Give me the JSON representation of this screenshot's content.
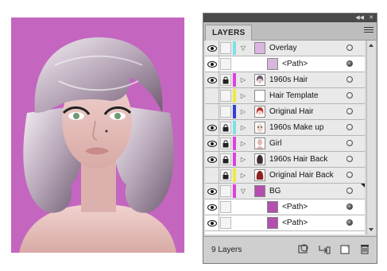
{
  "artwork": {
    "description_label": ""
  },
  "panel": {
    "tab_label": "LAYERS",
    "layer_count_label": "9 Layers",
    "footer_buttons": [
      "make-clip-mask",
      "create-sublayer",
      "create-layer",
      "delete-layer"
    ]
  },
  "layers": [
    {
      "name": "Overlay",
      "expander": "▽",
      "color": "#7ee0e8",
      "visible": true,
      "locked": false,
      "thumb": "lilac",
      "level": 0,
      "selected_corner": false
    },
    {
      "name": "<Path>",
      "expander": "",
      "color": "",
      "visible": true,
      "locked": false,
      "thumb": "lilac",
      "level": 1,
      "selected_corner": false
    },
    {
      "name": "1960s Hair",
      "expander": "▷",
      "color": "#e040e0",
      "visible": true,
      "locked": true,
      "thumb": "hair",
      "level": 0,
      "selected_corner": false
    },
    {
      "name": "Hair Template",
      "expander": "▷",
      "color": "#f0e840",
      "visible": false,
      "locked": false,
      "thumb": "blank",
      "level": 0,
      "selected_corner": false
    },
    {
      "name": "Original Hair",
      "expander": "▷",
      "color": "#3040d8",
      "visible": false,
      "locked": false,
      "thumb": "redhair",
      "level": 0,
      "selected_corner": false
    },
    {
      "name": "1960s Make up",
      "expander": "▷",
      "color": "#7ee0e8",
      "visible": true,
      "locked": true,
      "thumb": "face",
      "level": 0,
      "selected_corner": false
    },
    {
      "name": "Girl",
      "expander": "▷",
      "color": "#e040e0",
      "visible": true,
      "locked": true,
      "thumb": "girl",
      "level": 0,
      "selected_corner": false
    },
    {
      "name": "1960s Hair Back",
      "expander": "▷",
      "color": "#e040e0",
      "visible": true,
      "locked": true,
      "thumb": "darkhair",
      "level": 0,
      "selected_corner": false
    },
    {
      "name": "Original Hair Back",
      "expander": "▷",
      "color": "#f0e840",
      "visible": false,
      "locked": true,
      "thumb": "redhairback",
      "level": 0,
      "selected_corner": false
    },
    {
      "name": "BG",
      "expander": "▽",
      "color": "#e040e0",
      "visible": true,
      "locked": false,
      "thumb": "purple",
      "level": 0,
      "selected_corner": true
    },
    {
      "name": "<Path>",
      "expander": "",
      "color": "",
      "visible": true,
      "locked": false,
      "thumb": "purple",
      "level": 1,
      "selected_corner": false
    },
    {
      "name": "<Path>",
      "expander": "",
      "color": "",
      "visible": true,
      "locked": false,
      "thumb": "purple",
      "level": 1,
      "selected_corner": false
    }
  ],
  "colors": {
    "artwork_bg": "#c466bf",
    "panel_bg": "#d6d6d6",
    "titlebar": "#4a4a4a"
  }
}
